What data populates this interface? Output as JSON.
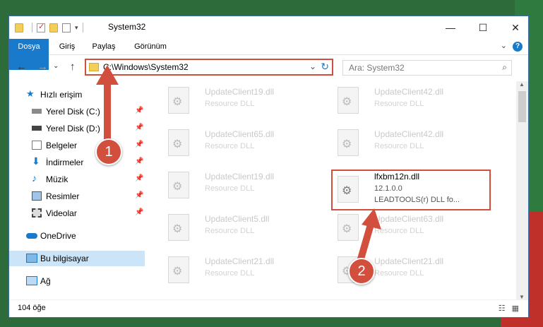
{
  "window": {
    "title": "System32",
    "controls": {
      "minimize": "—",
      "maximize": "☐",
      "close": "✕"
    }
  },
  "ribbon": {
    "tabs": [
      {
        "label": "Dosya"
      },
      {
        "label": "Giriş"
      },
      {
        "label": "Paylaş"
      },
      {
        "label": "Görünüm"
      }
    ],
    "help": "?",
    "collapse": "⌄"
  },
  "nav": {
    "back": "←",
    "forward": "→",
    "recent": "⌄",
    "up": "↑",
    "address": "C:\\Windows\\System32",
    "address_dropdown": "⌄",
    "refresh": "↻",
    "search_placeholder": "Ara: System32",
    "search_icon": "⌕"
  },
  "sidebar": {
    "items": [
      {
        "label": "Hızlı erişim",
        "icon": "star-icon"
      },
      {
        "label": "Yerel Disk (C:)",
        "icon": "drive-icon",
        "pin": "📌"
      },
      {
        "label": "Yerel Disk (D:)",
        "icon": "drive-icon",
        "pin": "📌"
      },
      {
        "label": "Belgeler",
        "icon": "documents-icon",
        "pin": "📌"
      },
      {
        "label": "İndirmeler",
        "icon": "downloads-icon",
        "pin": "📌"
      },
      {
        "label": "Müzik",
        "icon": "music-icon",
        "pin": "📌"
      },
      {
        "label": "Resimler",
        "icon": "pictures-icon",
        "pin": "📌"
      },
      {
        "label": "Videolar",
        "icon": "videos-icon",
        "pin": "📌"
      },
      {
        "label": "OneDrive",
        "icon": "cloud-icon"
      },
      {
        "label": "Bu bilgisayar",
        "icon": "computer-icon"
      },
      {
        "label": "Ağ",
        "icon": "network-icon"
      }
    ]
  },
  "files": [
    {
      "name": "UpdateClient19.dll",
      "desc": "Resource DLL"
    },
    {
      "name": "UpdateClient42.dll",
      "desc": "Resource DLL"
    },
    {
      "name": "UpdateClient65.dll",
      "desc": "Resource DLL"
    },
    {
      "name": "UpdateClient42.dll",
      "desc": "Resource DLL"
    },
    {
      "name": "UpdateClient19.dll",
      "desc": "Resource DLL"
    },
    {
      "name": "lfxbm12n.dll",
      "desc": "12.1.0.0",
      "desc2": "LEADTOOLS(r) DLL fo..."
    },
    {
      "name": "UpdateClient5.dll",
      "desc": "Resource DLL"
    },
    {
      "name": "UpdateClient63.dll",
      "desc": "Resource DLL"
    },
    {
      "name": "UpdateClient21.dll",
      "desc": "Resource DLL"
    },
    {
      "name": "UpdateClient21.dll",
      "desc": "Resource DLL"
    }
  ],
  "status": {
    "count": "104 öğe",
    "views": "☷ ▦"
  },
  "annotations": {
    "step1": "1",
    "step2": "2",
    "color": "#d24f3e"
  }
}
